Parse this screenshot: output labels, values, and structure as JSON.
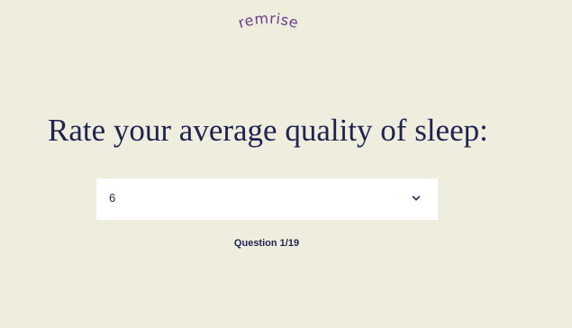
{
  "brand": {
    "logo_text": "remrise",
    "logo_color": "#6b3a8c"
  },
  "question": {
    "title": "Rate your average quality of sleep:",
    "selected_value": "6",
    "progress_label": "Question 1/19"
  },
  "icons": {
    "dropdown": "chevron-down-icon"
  },
  "colors": {
    "background": "#efeddd",
    "text": "#1f2350",
    "field": "#ffffff"
  }
}
